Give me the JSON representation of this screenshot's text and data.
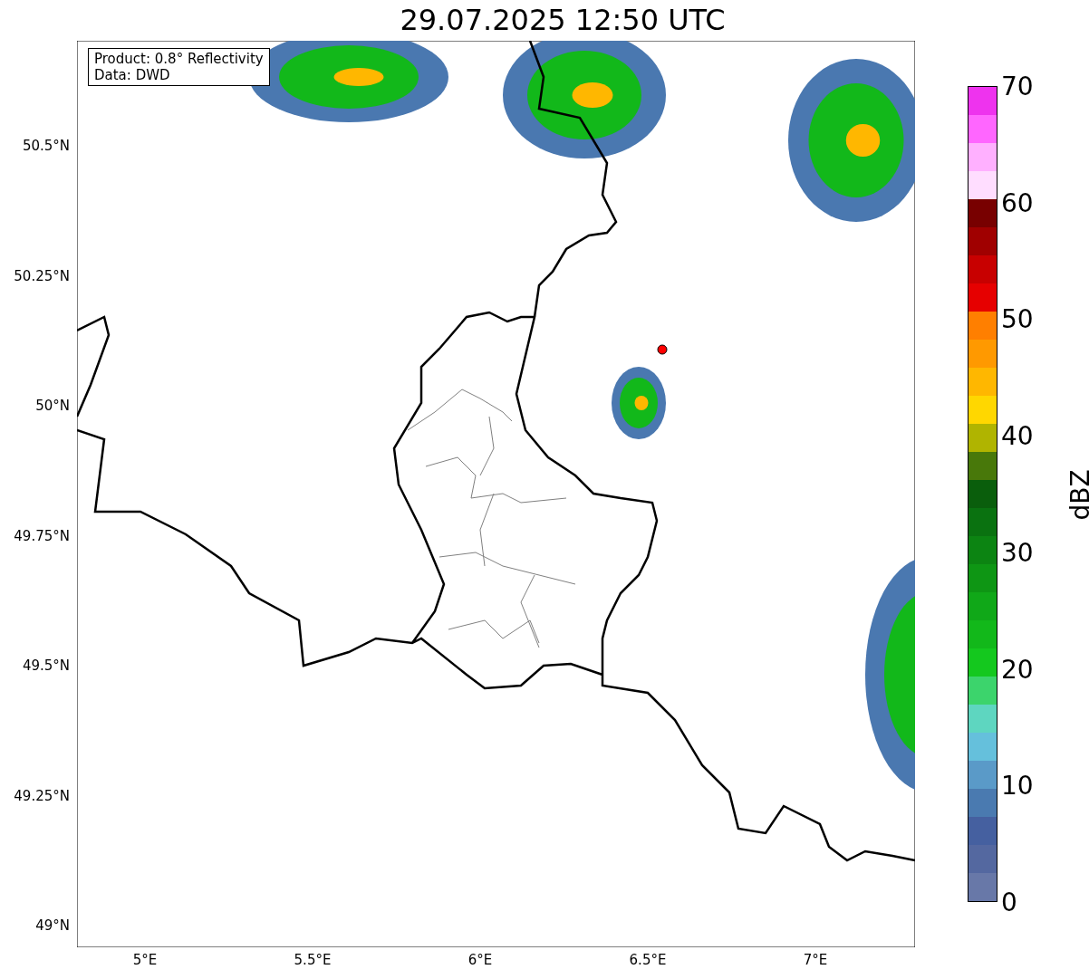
{
  "title": "29.07.2025 12:50 UTC",
  "map": {
    "legend": [
      "Product: 0.8° Reflectivity",
      "Data: DWD"
    ]
  },
  "y_ticks": [
    "50.5°N",
    "50.25°N",
    "50°N",
    "49.75°N",
    "49.5°N",
    "49.25°N",
    "49°N"
  ],
  "x_ticks": [
    "5°E",
    "5.5°E",
    "6°E",
    "6.5°E",
    "7°E"
  ],
  "colorbar": {
    "label": "dBZ",
    "ticks": [
      "70",
      "60",
      "50",
      "40",
      "30",
      "20",
      "10",
      "0"
    ],
    "segments": [
      {
        "color": "#6878a8"
      },
      {
        "color": "#5468a0"
      },
      {
        "color": "#4560a0"
      },
      {
        "color": "#4a7ab0"
      },
      {
        "color": "#5a9ac8"
      },
      {
        "color": "#65c0dc"
      },
      {
        "color": "#5ed6c0"
      },
      {
        "color": "#3cd46c"
      },
      {
        "color": "#14c81e"
      },
      {
        "color": "#12b81a"
      },
      {
        "color": "#10a818"
      },
      {
        "color": "#0e9614"
      },
      {
        "color": "#0c8412"
      },
      {
        "color": "#0a7210"
      },
      {
        "color": "#0a5e0c"
      },
      {
        "color": "#48780a"
      },
      {
        "color": "#b0b400"
      },
      {
        "color": "#ffd700"
      },
      {
        "color": "#ffb700"
      },
      {
        "color": "#ff9900"
      },
      {
        "color": "#ff7f00"
      },
      {
        "color": "#e60000"
      },
      {
        "color": "#c80000"
      },
      {
        "color": "#a00000"
      },
      {
        "color": "#780000"
      },
      {
        "color": "#ffddff"
      },
      {
        "color": "#ffb0ff"
      },
      {
        "color": "#ff66ff"
      },
      {
        "color": "#ee33ee"
      }
    ]
  }
}
